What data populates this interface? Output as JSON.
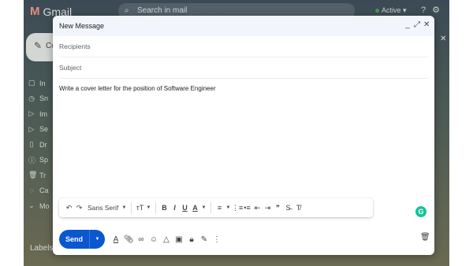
{
  "background_app": {
    "logo_text": "Gmail",
    "search_placeholder": "Search in mail",
    "status_label": "Active",
    "compose_label": "Co",
    "nav_items": [
      {
        "icon": "inbox-icon",
        "glyph": "▢",
        "label": "In"
      },
      {
        "icon": "snoozed-icon",
        "glyph": "◷",
        "label": "Sn"
      },
      {
        "icon": "important-icon",
        "glyph": "▷",
        "label": "Im"
      },
      {
        "icon": "sent-icon",
        "glyph": "▷",
        "label": "Se"
      },
      {
        "icon": "drafts-icon",
        "glyph": "▯",
        "label": "Dr"
      },
      {
        "icon": "spam-icon",
        "glyph": "ⓘ",
        "label": "Sp"
      },
      {
        "icon": "trash-icon",
        "glyph": "🗑",
        "label": "Tr"
      },
      {
        "icon": "categories-icon",
        "glyph": "◌",
        "label": "Ca"
      },
      {
        "icon": "more-icon",
        "glyph": "⌄",
        "label": "Mo"
      }
    ],
    "labels_heading": "Labels"
  },
  "compose": {
    "title": "New Message",
    "recipients_placeholder": "Recipients",
    "subject_placeholder": "Subject",
    "body": "Write a cover letter for the position of Software Engineer",
    "font_name": "Sans Serif",
    "send_label": "Send"
  },
  "colors": {
    "send_button": "#0b57d0",
    "header_bg": "#f2f6fc",
    "grammarly": "#15c39a"
  }
}
